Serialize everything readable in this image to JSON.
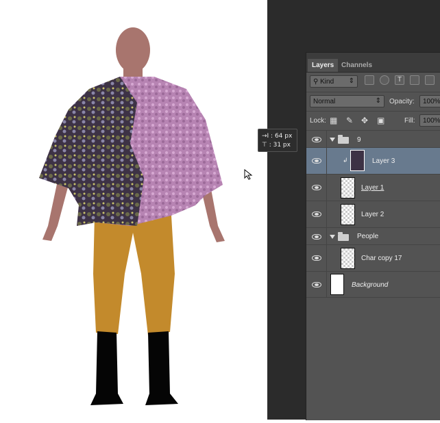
{
  "tabs": [
    "Layers",
    "Channels"
  ],
  "filter": {
    "kind_label": "Kind"
  },
  "blend": {
    "mode": "Normal",
    "opacity_label": "Opacity:",
    "opacity_value": "100%"
  },
  "lock": {
    "label": "Lock:",
    "fill_label": "Fill:",
    "fill_value": "100%"
  },
  "layers": [
    {
      "name": "9",
      "type": "group"
    },
    {
      "name": "Layer 3",
      "type": "layer",
      "selected": true,
      "clipped": true
    },
    {
      "name": "Layer 1",
      "type": "layer"
    },
    {
      "name": "Layer 2",
      "type": "layer"
    },
    {
      "name": "People",
      "type": "group"
    },
    {
      "name": "Char copy 17",
      "type": "layer"
    },
    {
      "name": "Background",
      "type": "background"
    }
  ],
  "tooltip": {
    "x": "64 px",
    "y": "31 px"
  },
  "colors": {
    "selected_row": "#687a8e",
    "panel_bg": "#535353",
    "workspace": "#2b2b2b"
  },
  "icons": [
    "eye-icon",
    "folder-icon",
    "search-icon",
    "lock-icon",
    "move-icon",
    "brush-icon",
    "cursor-icon"
  ]
}
